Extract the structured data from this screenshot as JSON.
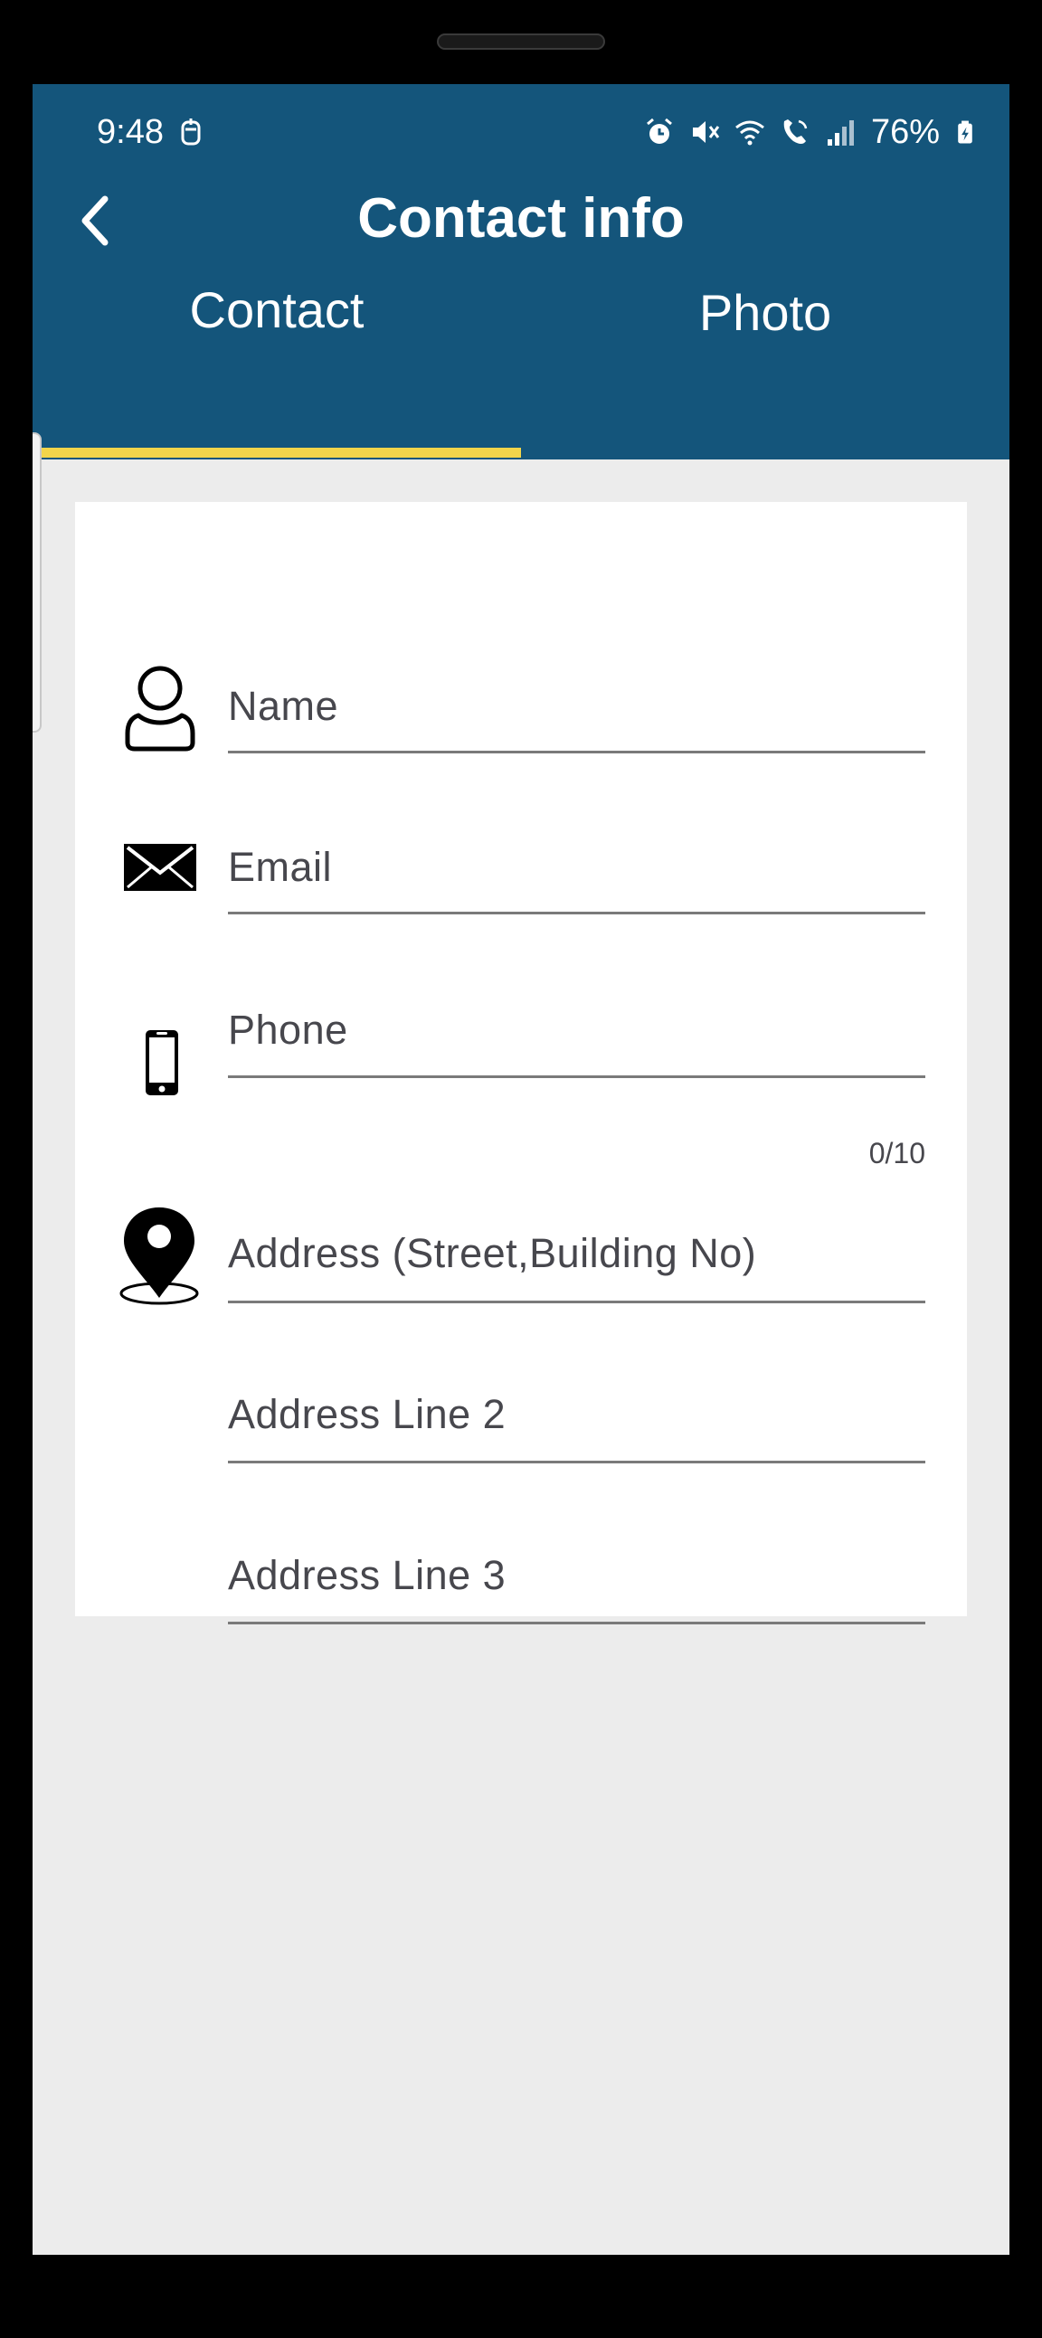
{
  "status_bar": {
    "time": "9:48",
    "battery": "76%"
  },
  "header": {
    "title": "Contact info",
    "back_icon": "chevron-left-icon"
  },
  "tabs": [
    {
      "label": "Contact",
      "selected": true
    },
    {
      "label": "Photo",
      "selected": false
    }
  ],
  "form": {
    "name_placeholder": "Name",
    "email_placeholder": "Email",
    "phone_placeholder": "Phone",
    "phone_counter": "0/10",
    "address1_placeholder": "Address (Street,Building No)",
    "address2_placeholder": "Address Line 2",
    "address3_placeholder": "Address Line 3"
  },
  "colors": {
    "appbar": "#14557b",
    "tab_indicator": "#f2d54a",
    "background": "#ececec"
  }
}
